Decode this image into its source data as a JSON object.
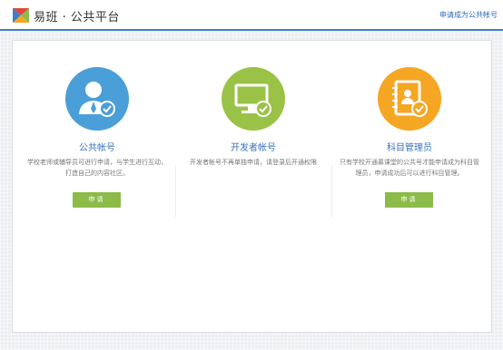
{
  "header": {
    "app_name": "易班 · 公共平台",
    "apply_link": "申请成为公共帐号"
  },
  "cards": [
    {
      "icon": "teacher-avatar-check-icon",
      "color": "#4a9fd8",
      "title": "公共帐号",
      "description": "学校老师或辅导员可进行申请，与学生进行互动，打造自己的内容社区。",
      "button": "申请"
    },
    {
      "icon": "monitor-check-icon",
      "color": "#9ac246",
      "title": "开发者帐号",
      "description": "开发者帐号不再单独申请，请登录后开通权限",
      "button": ""
    },
    {
      "icon": "address-book-check-icon",
      "color": "#f5a623",
      "title": "科目管理员",
      "description": "只有学校开通慕课堂的公共号才能申请成为科目管理员，申请成功后可以进行科目管理。",
      "button": "申请"
    }
  ]
}
